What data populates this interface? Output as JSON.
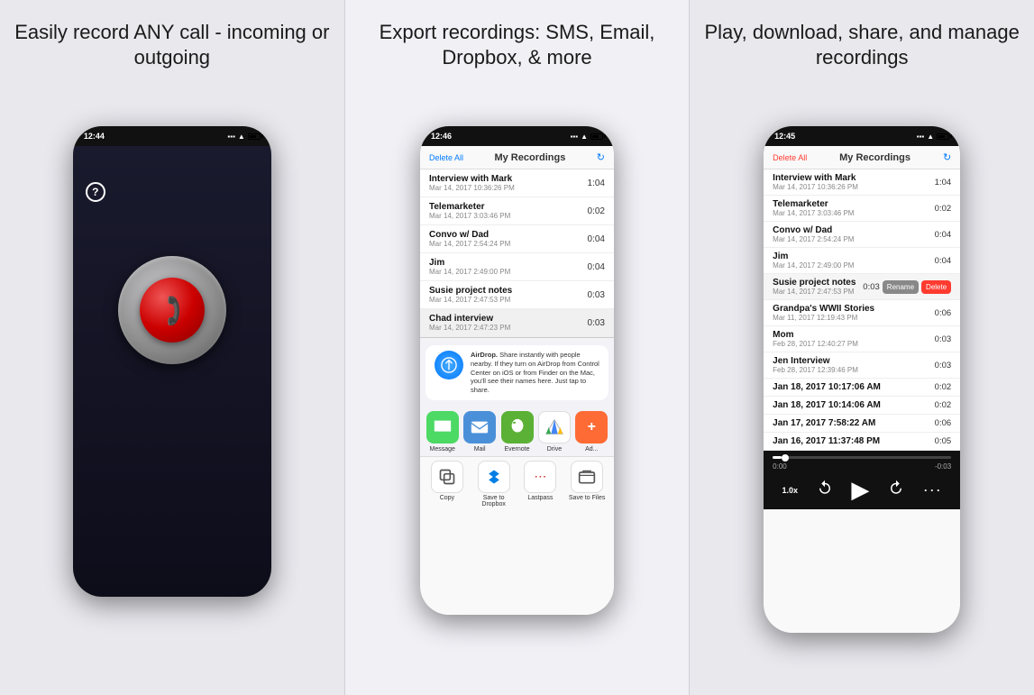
{
  "panel1": {
    "title": "Easily record ANY call - incoming or outgoing",
    "phone": {
      "time": "12:44",
      "screen": "record"
    }
  },
  "panel2": {
    "title": "Export recordings: SMS, Email, Dropbox, & more",
    "phone": {
      "time": "12:46",
      "header": {
        "delete_all": "Delete All",
        "title": "My Recordings"
      },
      "recordings": [
        {
          "name": "Interview with Mark",
          "date": "Mar 14, 2017 10:36:26 PM",
          "duration": "1:04"
        },
        {
          "name": "Telemarketer",
          "date": "Mar 14, 2017 3:03:46 PM",
          "duration": "0:02"
        },
        {
          "name": "Convo w/ Dad",
          "date": "Mar 14, 2017 2:54:24 PM",
          "duration": "0:04"
        },
        {
          "name": "Jim",
          "date": "Mar 14, 2017 2:49:00 PM",
          "duration": "0:04"
        },
        {
          "name": "Susie project notes",
          "date": "Mar 14, 2017 2:47:53 PM",
          "duration": "0:03"
        },
        {
          "name": "Chad interview",
          "date": "Mar 14, 2017 2:47:23 PM",
          "duration": "0:03"
        }
      ],
      "airdrop": {
        "title": "AirDrop.",
        "description": "Share instantly with people nearby. If they turn on AirDrop from Control Center on iOS or from Finder on the Mac, you'll see their names here. Just tap to share."
      },
      "share_apps": [
        {
          "label": "Message",
          "color": "#4cd964",
          "icon": "💬"
        },
        {
          "label": "Mail",
          "color": "#4a90d9",
          "icon": "✉️"
        },
        {
          "label": "Evernote",
          "color": "#5bb135",
          "icon": "🐘"
        },
        {
          "label": "Drive",
          "color": "#fbbd08",
          "icon": "▲"
        },
        {
          "label": "Ad...",
          "color": "#ff6b35",
          "icon": "+"
        }
      ],
      "share_actions": [
        {
          "label": "Copy",
          "icon": "⎘"
        },
        {
          "label": "Save to Dropbox",
          "icon": "📦"
        },
        {
          "label": "Lastpass",
          "icon": "⋯"
        },
        {
          "label": "Save to Files",
          "icon": "📁"
        }
      ]
    }
  },
  "panel3": {
    "title": "Play, download, share, and manage recordings",
    "phone": {
      "time": "12:45",
      "header": {
        "delete_all": "Delete All",
        "title": "My Recordings"
      },
      "recordings": [
        {
          "name": "Interview with Mark",
          "date": "Mar 14, 2017 10:36:26 PM",
          "duration": "1:04",
          "active": false
        },
        {
          "name": "Telemarketer",
          "date": "Mar 14, 2017 3:03:46 PM",
          "duration": "0:02",
          "active": false
        },
        {
          "name": "Convo w/ Dad",
          "date": "Mar 14, 2017 2:54:24 PM",
          "duration": "0:04",
          "active": false
        },
        {
          "name": "Jim",
          "date": "Mar 14, 2017 2:49:00 PM",
          "duration": "0:04",
          "active": false
        },
        {
          "name": "Susie project notes",
          "date": "Mar 14, 2017 2:47:53 PM",
          "duration": "0:03",
          "active": true
        },
        {
          "name": "Grandpa's WWII Stories",
          "date": "Mar 11, 2017 12:19:43 PM",
          "duration": "0:06",
          "active": false
        },
        {
          "name": "Mom",
          "date": "Feb 28, 2017 12:40:27 PM",
          "duration": "0:03",
          "active": false
        },
        {
          "name": "Jen Interview",
          "date": "Feb 28, 2017 12:39:46 PM",
          "duration": "0:03",
          "active": false
        },
        {
          "name": "Jan 18, 2017 10:17:06 AM",
          "date": "",
          "duration": "0:02",
          "active": false
        },
        {
          "name": "Jan 18, 2017 10:14:06 AM",
          "date": "",
          "duration": "0:02",
          "active": false
        },
        {
          "name": "Jan 17, 2017 7:58:22 AM",
          "date": "",
          "duration": "0:06",
          "active": false
        },
        {
          "name": "Jan 16, 2017 11:37:48 PM",
          "date": "",
          "duration": "0:05",
          "active": false
        }
      ],
      "active_row_actions": {
        "duration": "0:03",
        "rename": "Rename",
        "delete": "Delete"
      },
      "playback": {
        "current_time": "0:00",
        "total_time": "-0:03",
        "speed": "1.0x",
        "progress_percent": 5
      }
    }
  }
}
